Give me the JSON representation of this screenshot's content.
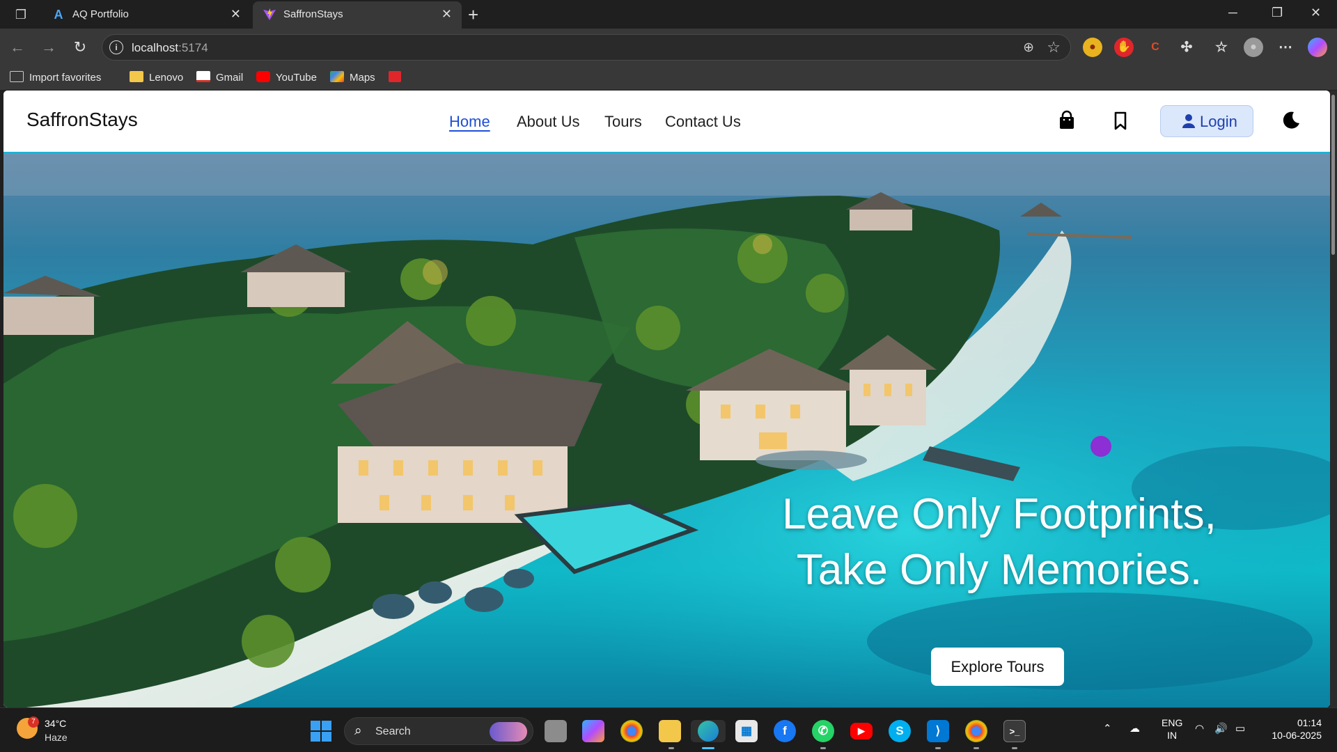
{
  "browser": {
    "tabs": [
      {
        "title": "AQ Portfolio",
        "favicon": "A"
      },
      {
        "title": "SaffronStays",
        "favicon": "vite-logo"
      }
    ],
    "url_host": "localhost",
    "url_port": ":5174",
    "bookmarks": [
      {
        "label": "Import favorites",
        "icon": "import-icon"
      },
      {
        "label": "Lenovo",
        "icon": "folder-icon"
      },
      {
        "label": "Gmail",
        "icon": "gmail-icon"
      },
      {
        "label": "YouTube",
        "icon": "youtube-icon"
      },
      {
        "label": "Maps",
        "icon": "maps-icon"
      },
      {
        "label": "",
        "icon": "pdf-icon"
      }
    ]
  },
  "site": {
    "brand": "SaffronStays",
    "nav": [
      {
        "label": "Home",
        "active": true
      },
      {
        "label": "About Us",
        "active": false
      },
      {
        "label": "Tours",
        "active": false
      },
      {
        "label": "Contact Us",
        "active": false
      }
    ],
    "login_label": "Login",
    "hero": {
      "line1": "Leave Only Footprints,",
      "line2": "Take Only Memories.",
      "cta": "Explore Tours"
    },
    "accent_color": "#1d4ed8"
  },
  "taskbar": {
    "weather_temp": "34°C",
    "weather_desc": "Haze",
    "weather_badge": "7",
    "search_label": "Search",
    "lang_1": "ENG",
    "lang_2": "IN",
    "time": "01:14",
    "date": "10-06-2025"
  }
}
